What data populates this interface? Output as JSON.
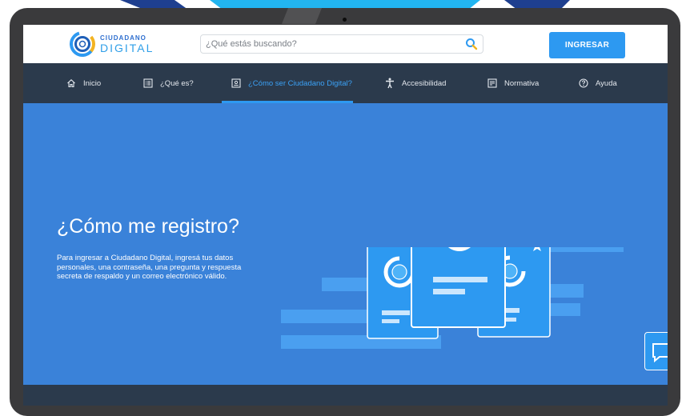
{
  "brand": {
    "line1": "CIUDADANO",
    "line2": "DIGITAL",
    "logo_icon": "ciudadano-digital-logo"
  },
  "search": {
    "placeholder": "¿Qué estás buscando?",
    "value": "",
    "icon": "search-icon"
  },
  "header": {
    "login_label": "INGRESAR"
  },
  "nav": {
    "items": [
      {
        "label": "Inicio",
        "icon": "home-icon"
      },
      {
        "label": "¿Qué es?",
        "icon": "list-icon"
      },
      {
        "label": "¿Cómo ser Ciudadano Digital?",
        "icon": "id-card-icon",
        "active": true
      },
      {
        "label": "Accesibilidad",
        "icon": "accessibility-icon"
      },
      {
        "label": "Normativa",
        "icon": "document-icon"
      },
      {
        "label": "Ayuda",
        "icon": "help-icon"
      }
    ]
  },
  "hero": {
    "title": "¿Cómo me registro?",
    "description": "Para ingresar a Ciudadano Digital, ingresá tus datos personales, una contraseña, una pregunta y respuesta secreta de respaldo y un correo electrónico válido."
  },
  "chat": {
    "icon": "chat-icon"
  },
  "colors": {
    "nav_bg": "#2b3a4c",
    "hero_bg": "#3a82d9",
    "accent": "#2d99f1",
    "decor_cyan": "#22b5f0",
    "decor_navy": "#1e3f8f"
  }
}
